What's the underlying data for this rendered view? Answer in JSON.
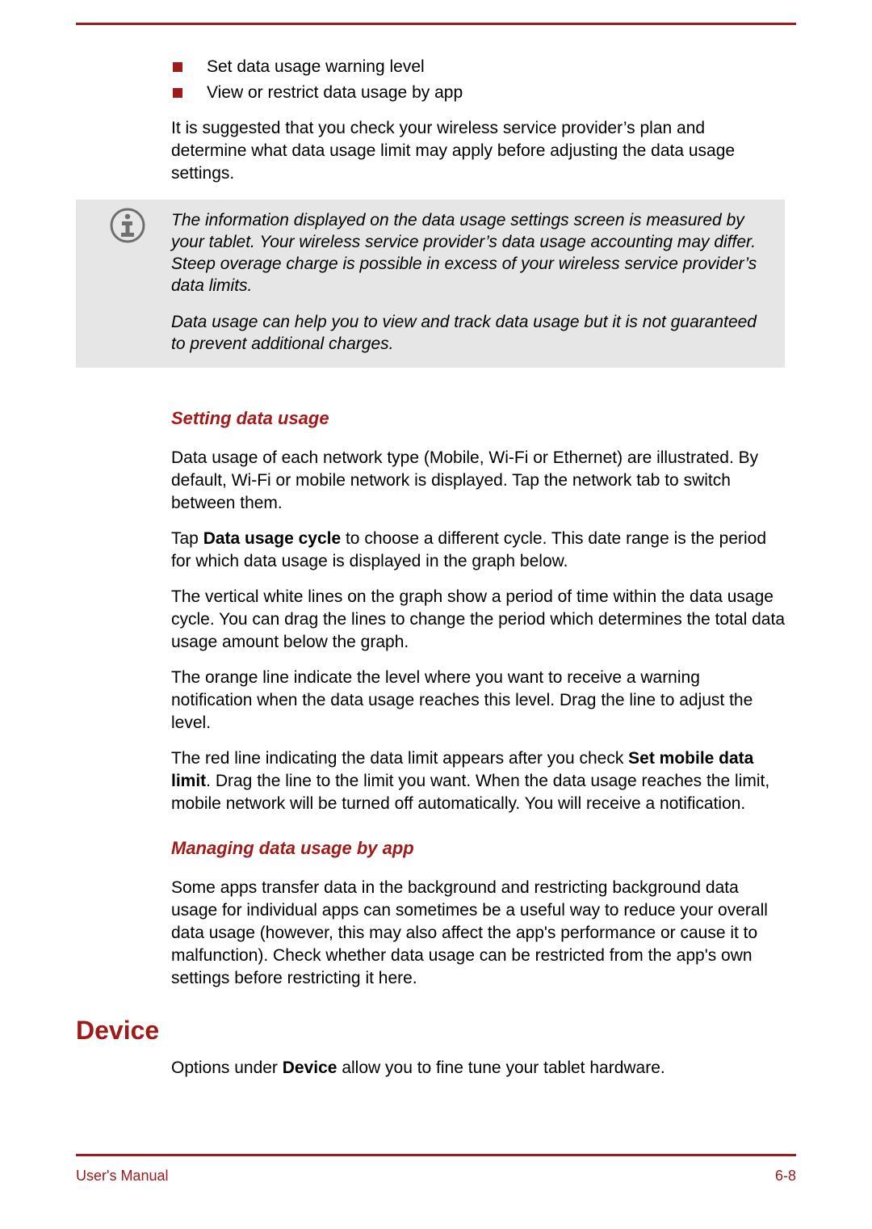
{
  "bullets": [
    "Set data usage warning level",
    "View or restrict data usage by app"
  ],
  "intro_para": "It is suggested that you check your wireless service provider’s plan and determine what data usage limit may apply before adjusting the data usage settings.",
  "note": {
    "para1": "The information displayed on the data usage settings screen is measured by your tablet. Your wireless service provider’s data usage accounting may differ. Steep overage charge is possible in excess of your wireless service provider’s data limits.",
    "para2": "Data usage can help you to view and track data usage but it is not guaranteed to prevent additional charges."
  },
  "section1": {
    "heading": "Setting data usage",
    "p1": "Data usage of each network type (Mobile, Wi-Fi or Ethernet) are illustrated. By default, Wi-Fi or mobile network is displayed. Tap the network tab to switch between them.",
    "p2_pre": "Tap ",
    "p2_bold": "Data usage cycle",
    "p2_post": " to choose a different cycle. This date range is the period for which data usage is displayed in the graph below.",
    "p3": "The vertical white lines on the graph show a period of time within the data usage cycle. You can drag the lines to change the period which determines the total data usage amount below the graph.",
    "p4": "The orange line indicate the level where you want to receive a warning notification when the data usage reaches this level. Drag the line to adjust the level.",
    "p5_pre": "The red line indicating the data limit appears after you check ",
    "p5_bold": "Set mobile data limit",
    "p5_post": ". Drag the line to the limit you want. When the data usage reaches the limit, mobile network will be turned off automatically. You will receive a notification."
  },
  "section2": {
    "heading": "Managing data usage by app",
    "p1": "Some apps transfer data in the background and restricting background data usage for individual apps can sometimes be a useful way to reduce your overall data usage (however, this may also affect the app's performance or cause it to malfunction). Check whether data usage can be restricted from the app's own settings before restricting it here."
  },
  "device": {
    "heading": "Device",
    "p1_pre": "Options under ",
    "p1_bold": "Device",
    "p1_post": " allow you to fine tune your tablet hardware."
  },
  "footer": {
    "left": "User's Manual",
    "right": "6-8"
  },
  "colors": {
    "accent": "#a11a1a",
    "note_bg": "#e6e6e6"
  }
}
